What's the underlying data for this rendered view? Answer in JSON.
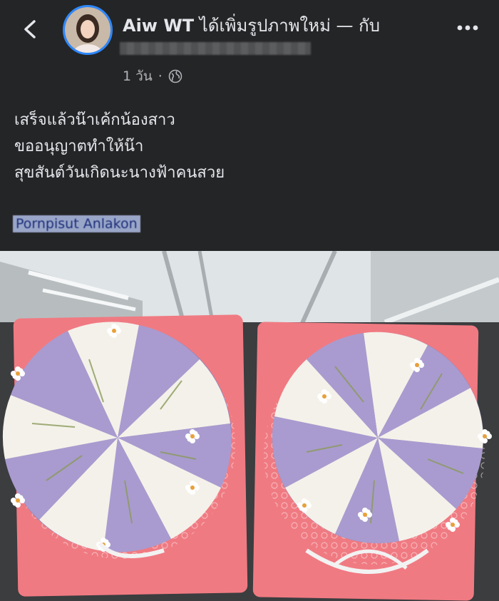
{
  "header": {
    "author": "Aiw WT",
    "action_text": " ได้เพิ่มรูปภาพใหม่ — กับ",
    "timestamp": "1 วัน",
    "separator": "·",
    "icons": {
      "back": "chevron-left-icon",
      "more": "more-dots-icon",
      "privacy": "globe-icon"
    }
  },
  "post": {
    "lines": [
      "เสร็จแล้วน๊าเค้กน้องสาว",
      "ขออนุญาตทำให้น๊า",
      "สุขสันต์วันเกิดนะนางฟ้าคนสวย"
    ],
    "tag": "Pornpisut Anlakon"
  },
  "colors": {
    "background": "#242526",
    "text": "#e4e6eb",
    "secondary_text": "#b0b3b8",
    "accent_ring": "#2d88ff",
    "cake_purple": "#a99bcf",
    "cake_white": "#f4f1ea",
    "board_pink": "#f07a82"
  }
}
